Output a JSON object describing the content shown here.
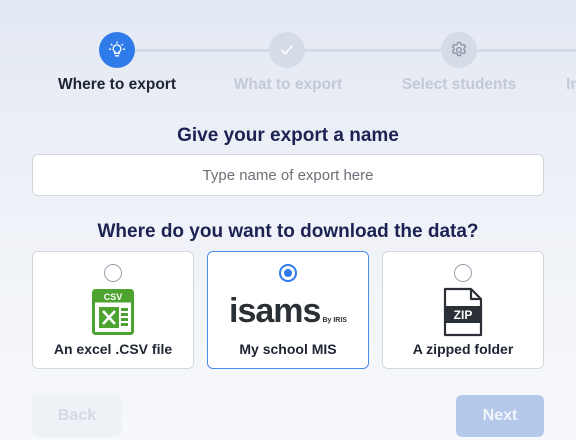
{
  "stepper": {
    "steps": [
      {
        "label": "Where to export",
        "icon": "lightbulb-icon",
        "state": "active"
      },
      {
        "label": "What to export",
        "icon": "check-icon",
        "state": "pending"
      },
      {
        "label": "Select students",
        "icon": "gear-icon",
        "state": "pending"
      },
      {
        "label": "In",
        "icon": "",
        "state": "pending"
      }
    ]
  },
  "name_section": {
    "heading": "Give your export a name",
    "placeholder": "Type name of export here",
    "value": ""
  },
  "download_section": {
    "heading": "Where do you want to download the data?",
    "options": [
      {
        "label": "An excel .CSV file",
        "icon": "csv-file-icon",
        "icon_badge": "CSV",
        "selected": false
      },
      {
        "label": "My school MIS",
        "icon": "isams-logo",
        "logo_text": "isams",
        "logo_sub": "By IRIS",
        "selected": true
      },
      {
        "label": "A zipped folder",
        "icon": "zip-file-icon",
        "icon_badge": "ZIP",
        "selected": false
      }
    ]
  },
  "footer": {
    "back_label": "Back",
    "next_label": "Next"
  },
  "colors": {
    "accent": "#2f7bea",
    "heading": "#1c2352",
    "csv_green": "#4ca32f"
  }
}
